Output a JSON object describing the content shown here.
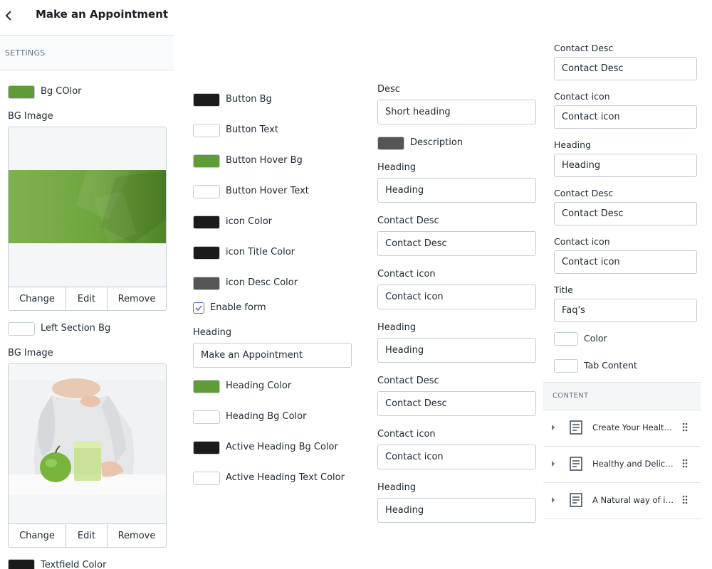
{
  "header": {
    "title": "Make an Appointment",
    "back_icon": "chevron-left-icon"
  },
  "settings_heading": "SETTINGS",
  "col1": {
    "bg_color": {
      "label": "Bg COlor",
      "color": "#5f9b37"
    },
    "bg_image1": {
      "label": "BG Image",
      "change": "Change",
      "edit": "Edit",
      "remove": "Remove"
    },
    "left_section_bg": {
      "label": "Left Section Bg",
      "color": "#ffffff"
    },
    "bg_image2": {
      "label": "BG Image",
      "change": "Change",
      "edit": "Edit",
      "remove": "Remove"
    },
    "textfield_color": {
      "label": "Textfield Color",
      "color": "#1b1b1b"
    }
  },
  "col2": {
    "colors": [
      {
        "label": "Button Bg",
        "color": "#1b1b1b"
      },
      {
        "label": "Button Text",
        "color": "#ffffff"
      },
      {
        "label": "Button Hover Bg",
        "color": "#5f9b37"
      },
      {
        "label": "Button Hover Text",
        "color": "#ffffff"
      },
      {
        "label": "icon Color",
        "color": "#1b1b1b"
      },
      {
        "label": "icon Title Color",
        "color": "#1b1b1b"
      },
      {
        "label": "icon Desc Color",
        "color": "#555555"
      }
    ],
    "enable_form": {
      "label": "Enable form",
      "checked": true
    },
    "heading": {
      "label": "Heading",
      "value": "Make an Appointment"
    },
    "colors2": [
      {
        "label": "Heading Color",
        "color": "#5f9b37"
      },
      {
        "label": "Heading Bg Color",
        "color": "#ffffff"
      },
      {
        "label": "Active Heading Bg Color",
        "color": "#1b1b1b"
      },
      {
        "label": "Active Heading Text Color",
        "color": "#ffffff"
      }
    ]
  },
  "col3": {
    "desc": {
      "label": "Desc",
      "value": "Short heading"
    },
    "description_color": {
      "label": "Description",
      "color": "#555555"
    },
    "fields": [
      {
        "label": "Heading",
        "value": "Heading"
      },
      {
        "label": "Contact Desc",
        "value": "Contact Desc"
      },
      {
        "label": "Contact icon",
        "value": "Contact icon"
      },
      {
        "label": "Heading",
        "value": "Heading"
      },
      {
        "label": "Contact Desc",
        "value": "Contact Desc"
      },
      {
        "label": "Contact icon",
        "value": "Contact icon"
      },
      {
        "label": "Heading",
        "value": "Heading"
      }
    ]
  },
  "col4": {
    "fields": [
      {
        "label": "Contact Desc",
        "value": "Contact Desc"
      },
      {
        "label": "Contact icon",
        "value": "Contact icon"
      },
      {
        "label": "Heading",
        "value": "Heading"
      },
      {
        "label": "Contact Desc",
        "value": "Contact Desc"
      },
      {
        "label": "Contact icon",
        "value": "Contact icon"
      },
      {
        "label": "Title",
        "value": "Faq's"
      }
    ],
    "color": {
      "label": "Color",
      "color": "#ffffff"
    },
    "tab_content": {
      "label": "Tab Content",
      "color": "#ffffff"
    }
  },
  "content": {
    "heading": "CONTENT",
    "blocks": [
      {
        "label": "Create Your Healthier Life"
      },
      {
        "label": "Healthy and Delicious Food"
      },
      {
        "label": "A Natural way of improving"
      }
    ]
  },
  "icons": {
    "block": "text-block-icon",
    "drag": "drag-handle-icon",
    "caret": "caret-right-icon"
  }
}
